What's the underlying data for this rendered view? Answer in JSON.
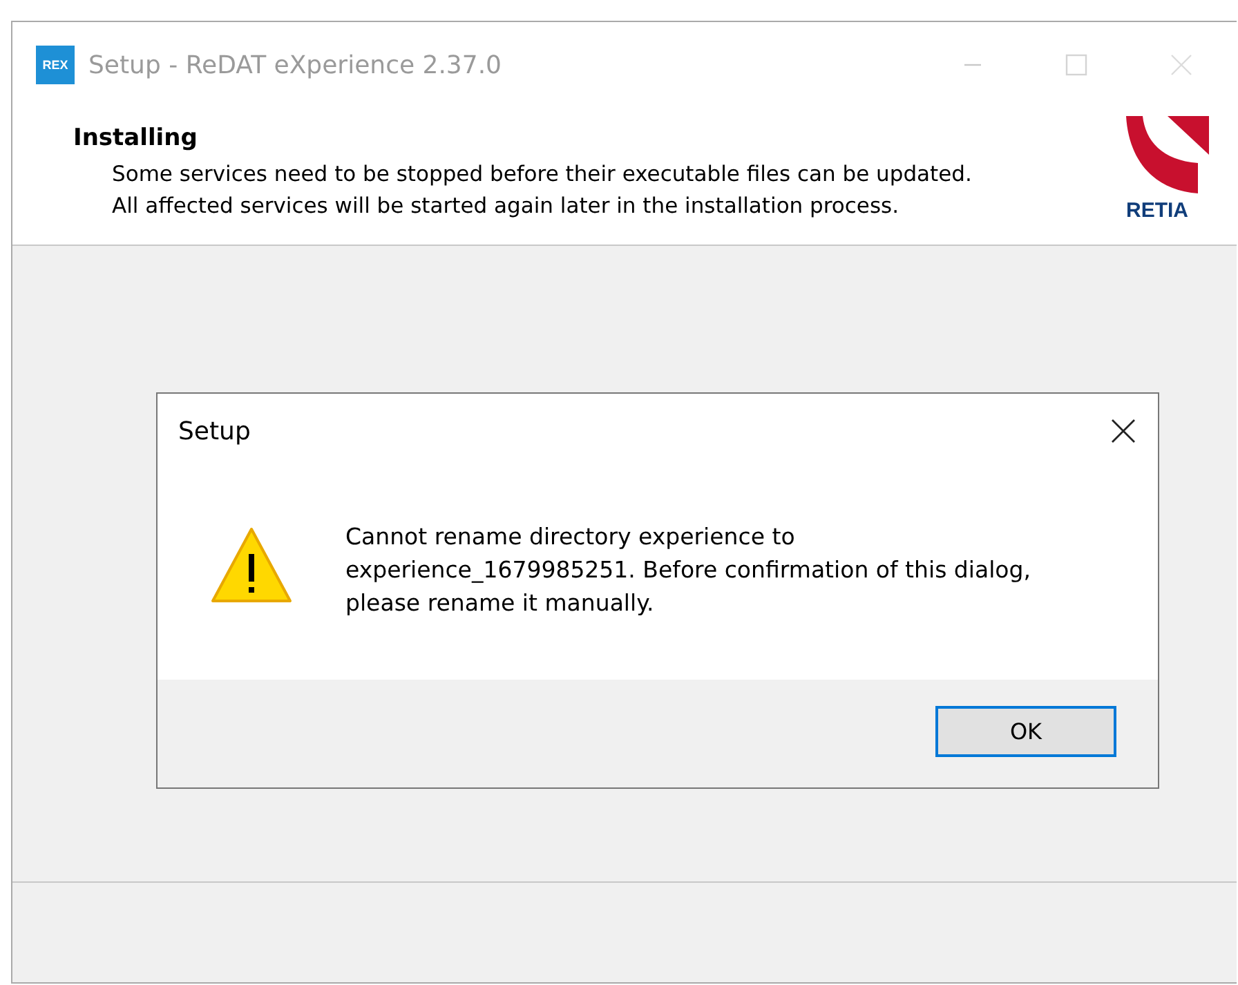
{
  "window": {
    "app_icon": "REX",
    "title": "Setup - ReDAT eXperience 2.37.0"
  },
  "header": {
    "heading": "Installing",
    "description_lines": [
      "Some services need to be stopped before their executable files can be updated.",
      "All affected services will be started again later in the installation process."
    ],
    "logo_text": "RETIA"
  },
  "dialog": {
    "title": "Setup",
    "message_lines": [
      "Cannot rename directory experience to",
      "experience_1679985251. Before confirmation of this dialog,",
      "please rename it manually."
    ],
    "buttons": [
      {
        "label": "OK",
        "selected": true
      }
    ]
  }
}
